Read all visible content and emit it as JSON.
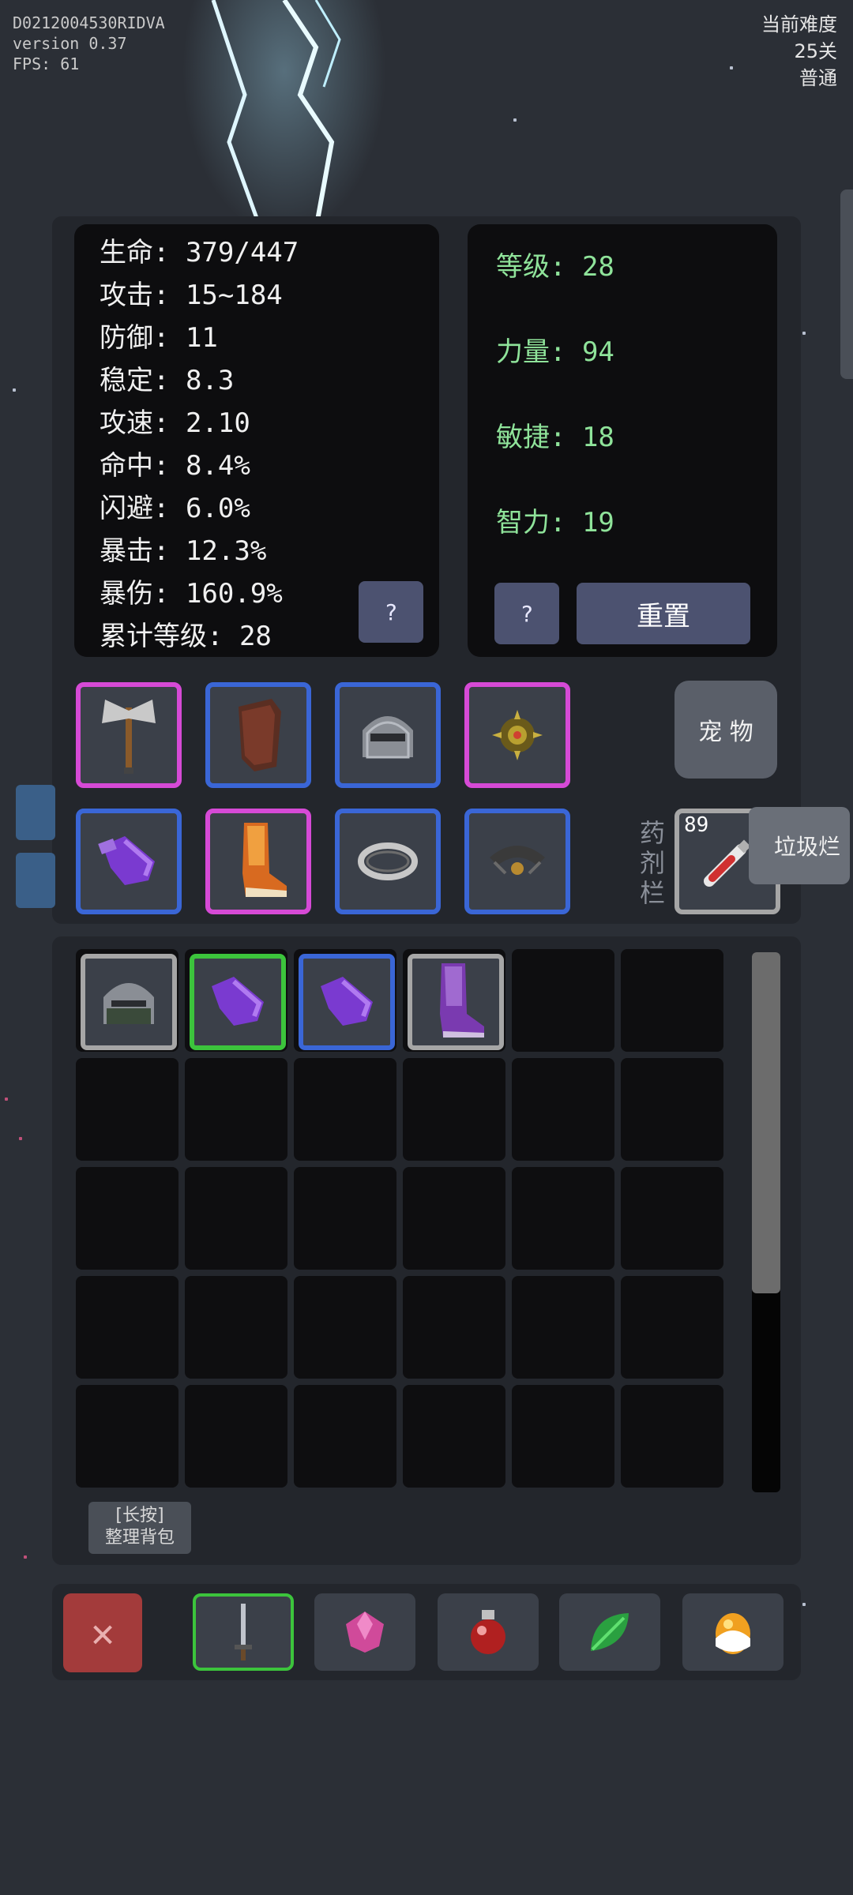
{
  "debug": {
    "device_id": "D0212004530RIDVA",
    "version": "version 0.37",
    "fps": "FPS: 61"
  },
  "difficulty": {
    "title": "当前难度",
    "level": "25关",
    "mode": "普通"
  },
  "stats": [
    "生命: 379/447",
    "攻击: 15~184",
    "防御: 11",
    "稳定: 8.3",
    "攻速: 2.10",
    "命中: 8.4%",
    "闪避: 6.0%",
    "暴击: 12.3%",
    "暴伤: 160.9%",
    "累计等级: 28"
  ],
  "attributes": [
    "等级: 28",
    "力量: 94",
    "敏捷: 18",
    "智力: 19"
  ],
  "buttons": {
    "help_left": "?",
    "help_right": "?",
    "reset": "重置",
    "pet": "宠 物",
    "side_tab": "垃圾烂",
    "sort_line1": "[长按]",
    "sort_line2": "整理背包",
    "close": "✕"
  },
  "potion": {
    "label": "药剂栏",
    "count": "89"
  },
  "equipment": [
    {
      "name": "axe-icon",
      "rarity": "purple"
    },
    {
      "name": "armor-icon",
      "rarity": "blue"
    },
    {
      "name": "helmet-icon",
      "rarity": "blue"
    },
    {
      "name": "amulet-icon",
      "rarity": "purple"
    },
    {
      "name": "gloves-icon",
      "rarity": "blue"
    },
    {
      "name": "boots-icon",
      "rarity": "purple"
    },
    {
      "name": "ring-icon",
      "rarity": "blue"
    },
    {
      "name": "necklace-icon",
      "rarity": "blue"
    }
  ],
  "inventory": [
    {
      "name": "helmet-icon",
      "rarity": "gray"
    },
    {
      "name": "gloves-icon",
      "rarity": "green"
    },
    {
      "name": "gloves-icon",
      "rarity": "blue"
    },
    {
      "name": "boots-icon",
      "rarity": "gray"
    }
  ],
  "bottom_tabs": [
    "sword-icon",
    "gem-icon",
    "potion-icon",
    "leaf-icon",
    "egg-icon"
  ],
  "colors": {
    "purple": "#d64ad6",
    "blue": "#3a66d6",
    "green": "#3cc43c",
    "gray": "#a6a6a6",
    "attr_text": "#8fe39a"
  }
}
